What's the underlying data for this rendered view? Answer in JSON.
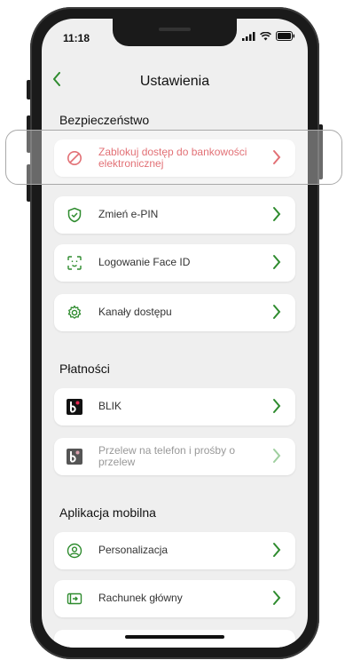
{
  "status": {
    "time": "11:18"
  },
  "nav": {
    "title": "Ustawienia",
    "back_icon": "chevron-left-icon"
  },
  "sections": {
    "security": {
      "header": "Bezpieczeństwo",
      "items": [
        {
          "label": "Zablokuj dostęp do bankowości elektronicznej",
          "icon": "block-icon",
          "style": "danger"
        },
        {
          "label": "Zmień e-PIN",
          "icon": "shield-check-icon"
        },
        {
          "label": "Logowanie Face ID",
          "icon": "face-id-icon"
        },
        {
          "label": "Kanały dostępu",
          "icon": "gear-icon"
        }
      ]
    },
    "payments": {
      "header": "Płatności",
      "items": [
        {
          "label": "BLIK",
          "icon": "blik-icon"
        },
        {
          "label": "Przelew na telefon i prośby o przelew",
          "icon": "blik-icon",
          "style": "muted"
        }
      ]
    },
    "mobile": {
      "header": "Aplikacja mobilna",
      "items": [
        {
          "label": "Personalizacja",
          "icon": "user-circle-icon"
        },
        {
          "label": "Rachunek główny",
          "icon": "card-arrow-icon"
        }
      ]
    }
  },
  "colors": {
    "accent": "#2e8b2e",
    "danger": "#d3242c",
    "background": "#efefef"
  }
}
